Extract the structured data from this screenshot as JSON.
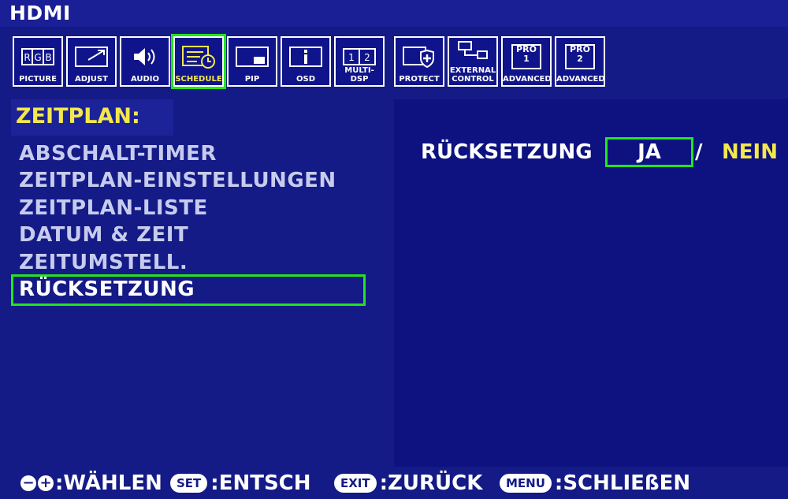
{
  "header": {
    "title": "HDMI"
  },
  "tabs": [
    {
      "label": "PICTURE"
    },
    {
      "label": "ADJUST"
    },
    {
      "label": "AUDIO"
    },
    {
      "label": "SCHEDULE"
    },
    {
      "label": "PIP"
    },
    {
      "label": "OSD"
    },
    {
      "label": "MULTI-DSP"
    },
    {
      "label": "PROTECT"
    },
    {
      "label": "EXTERNAL\nCONTROL"
    },
    {
      "label": "ADVANCED",
      "icon_text": "PRO\n1"
    },
    {
      "label": "ADVANCED",
      "icon_text": "PRO\n2"
    }
  ],
  "section": {
    "title": "ZEITPLAN:"
  },
  "menu": {
    "items": [
      "ABSCHALT-TIMER",
      "ZEITPLAN-EINSTELLUNGEN",
      "ZEITPLAN-LISTE",
      "DATUM & ZEIT",
      "ZEITUMSTELL.",
      "RÜCKSETZUNG"
    ]
  },
  "reset": {
    "label": "RÜCKSETZUNG",
    "yes": "JA",
    "slash": "/",
    "no": "NEIN"
  },
  "footer": {
    "minus_plus": ":WÄHLEN",
    "set_pill": "SET",
    "set_text": ":ENTSCH",
    "exit_pill": "EXIT",
    "exit_text": ":ZURÜCK",
    "menu_pill": "MENU",
    "menu_text": ":SCHLIEßEN"
  },
  "colors": {
    "background": "#141a86",
    "highlight": "#22e51c",
    "accent": "#f4e84a"
  }
}
